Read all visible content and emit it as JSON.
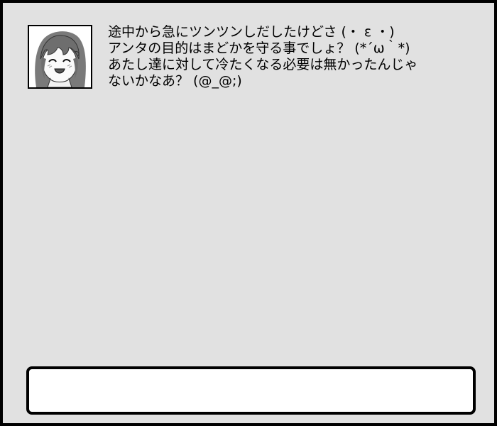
{
  "dialogue": {
    "lines": [
      "途中から急にツンツンしだしたけどさ (・ ε ・)",
      "アンタの目的はまどかを守る事でしょ？ (*´ω｀*)",
      "あたし達に対して冷たくなる必要は無かったんじゃ",
      "ないかなあ？ (@_@;)"
    ]
  },
  "portrait": {
    "icon": "character-portrait"
  },
  "input": {
    "value": ""
  }
}
